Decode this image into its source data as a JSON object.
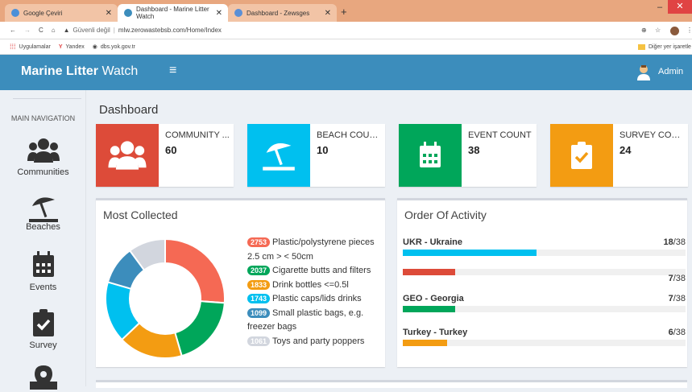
{
  "browser": {
    "tabs": [
      {
        "title": "Google Çeviri",
        "favicon_color": "#4a90d9"
      },
      {
        "title": "Dashboard - Marine Litter Watch",
        "favicon_color": "#3c8dbc"
      },
      {
        "title": "Dashboard - Zewsges",
        "favicon_color": "#5a8fd6"
      }
    ],
    "security_label": "Güvenli değil",
    "url": "mlw.zerowastebsb.com/Home/Index",
    "bookmarks": [
      "Uygulamalar",
      "Yandex",
      "dbs.yok.gov.tr"
    ],
    "other_bookmarks": "Diğer yer işaretle"
  },
  "header": {
    "brand_bold": "Marine Litter",
    "brand_light": " Watch",
    "user": "Admin",
    "color": "#3c8dbc"
  },
  "sidebar": {
    "heading": "MAIN NAVIGATION",
    "items": [
      {
        "label": "Communities",
        "icon": "users-icon"
      },
      {
        "label": "Beaches",
        "icon": "umbrella-beach-icon"
      },
      {
        "label": "Events",
        "icon": "calendar-icon"
      },
      {
        "label": "Survey",
        "icon": "clipboard-check-icon"
      },
      {
        "label": "",
        "icon": "map-marker-icon"
      }
    ]
  },
  "page_title": "Dashboard",
  "info_boxes": [
    {
      "label": "COMMUNITY ...",
      "value": "60",
      "color": "#dd4b39",
      "icon": "users-icon"
    },
    {
      "label": "BEACH COUNT",
      "value": "10",
      "color": "#00c0ef",
      "icon": "umbrella-beach-icon"
    },
    {
      "label": "EVENT COUNT",
      "value": "38",
      "color": "#00a65a",
      "icon": "calendar-icon"
    },
    {
      "label": "SURVEY COUNT",
      "value": "24",
      "color": "#f39c12",
      "icon": "clipboard-check-icon"
    }
  ],
  "most_collected": {
    "title": "Most Collected",
    "items": [
      {
        "count": 2753,
        "count_label": "2753",
        "label": "Plastic/polystyrene pieces 2.5 cm > < 50cm",
        "color": "#f56954"
      },
      {
        "count": 2037,
        "count_label": "2037",
        "label": "Cigarette butts and filters",
        "color": "#00a65a"
      },
      {
        "count": 1833,
        "count_label": "1833",
        "label": "Drink bottles <=0.5l",
        "color": "#f39c12"
      },
      {
        "count": 1743,
        "count_label": "1743",
        "label": "Plastic caps/lids drinks",
        "color": "#00c0ef"
      },
      {
        "count": 1099,
        "count_label": "1099",
        "label": "Small plastic bags, e.g. freezer bags",
        "color": "#3c8dbc"
      },
      {
        "count": 1061,
        "count_label": "1061",
        "label": "Toys and party poppers",
        "color": "#d2d6de"
      }
    ]
  },
  "order_of_activity": {
    "title": "Order Of Activity",
    "rows": [
      {
        "name": "UKR - Ukraine",
        "count": "18",
        "total": "/38",
        "fraction": 0.474,
        "color": "#00c0ef"
      },
      {
        "name": "",
        "count": "7",
        "total": "/38",
        "fraction": 0.184,
        "color": "#dd4b39"
      },
      {
        "name": "GEO - Georgia",
        "count": "7",
        "total": "/38",
        "fraction": 0.184,
        "color": "#00a65a"
      },
      {
        "name": "Turkey - Turkey",
        "count": "6",
        "total": "/38",
        "fraction": 0.158,
        "color": "#f39c12"
      }
    ]
  }
}
